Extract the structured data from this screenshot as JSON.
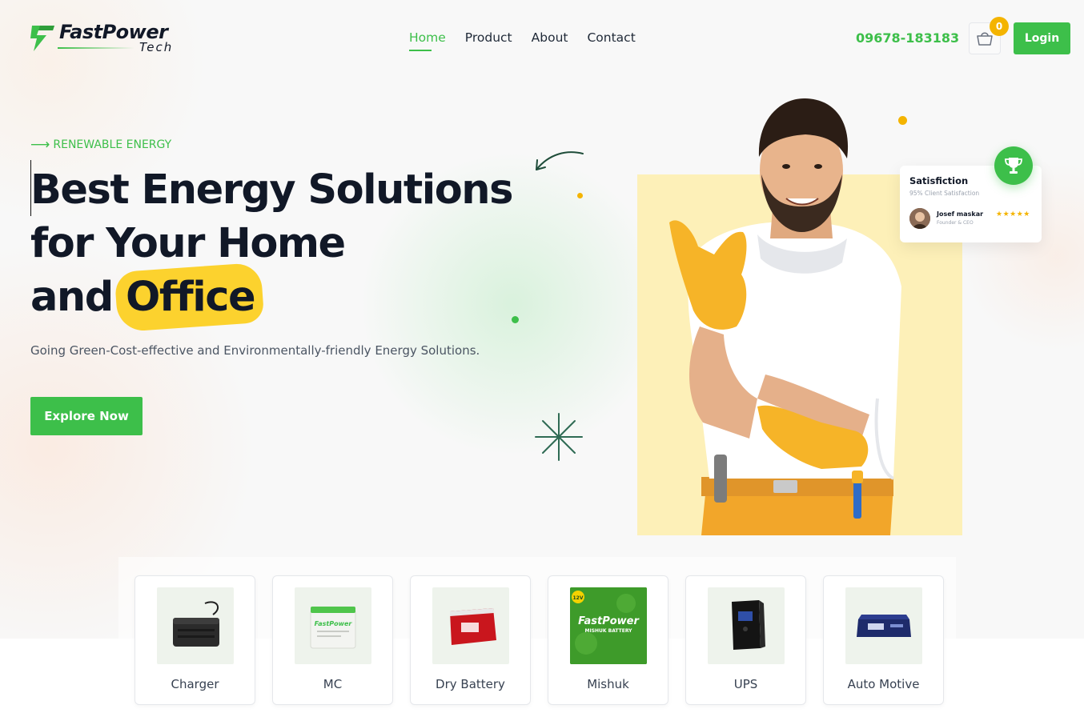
{
  "brand": {
    "name": "FastPower",
    "sub": "Tech"
  },
  "nav": {
    "items": [
      {
        "label": "Home",
        "active": true
      },
      {
        "label": "Product",
        "active": false
      },
      {
        "label": "About",
        "active": false
      },
      {
        "label": "Contact",
        "active": false
      }
    ]
  },
  "header": {
    "phone": "09678-183183",
    "cart_count": "0",
    "login_label": "Login"
  },
  "hero": {
    "eyebrow": "RENEWABLE ENERGY",
    "headline_line1": "Best Energy Solutions",
    "headline_line2": "for Your Home",
    "headline_line3_prefix": "and",
    "headline_highlight": "Office",
    "tagline": "Going Green-Cost-effective and Environmentally-friendly Energy Solutions.",
    "cta_label": "Explore Now"
  },
  "satisfaction": {
    "title": "Satisfiction",
    "subtitle": "95% Client Satisfaction",
    "reviewer_name": "Josef maskar",
    "reviewer_role": "Founder & CEO",
    "stars": "★★★★★"
  },
  "categories": [
    {
      "label": "Charger"
    },
    {
      "label": "MC"
    },
    {
      "label": "Dry Battery"
    },
    {
      "label": "Mishuk"
    },
    {
      "label": "UPS"
    },
    {
      "label": "Auto Motive"
    }
  ],
  "product_text": {
    "mc_brand": "FastPower",
    "mishuk_brand": "FastPower",
    "mishuk_caption": "MISHUK BATTERY",
    "mishuk_volt": "12V"
  },
  "colors": {
    "accent": "#3dbf4a",
    "highlight": "#fcd22e",
    "badge": "#f4b400"
  },
  "icons": [
    "bolt-logo-icon",
    "cart-icon",
    "trophy-icon",
    "arrow-right-icon",
    "curved-arrow-icon",
    "sparkle-icon"
  ]
}
